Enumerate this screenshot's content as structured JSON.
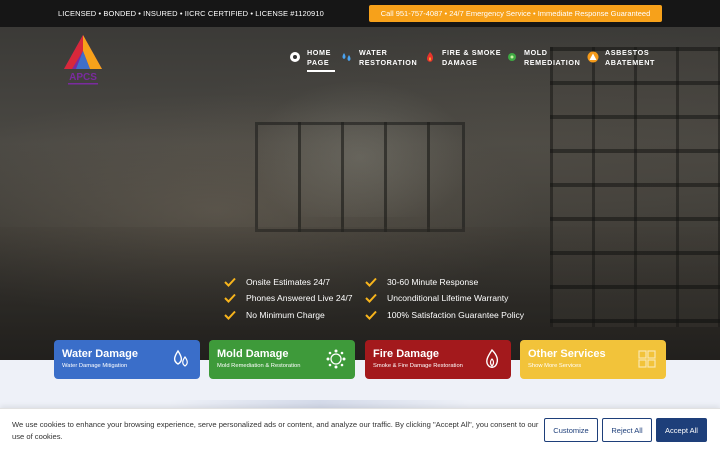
{
  "topbar": {
    "license_text": "LICENSED • BONDED • INSURED • IICRC CERTIFIED • LICENSE #1120910",
    "call_text": "Call 951-757-4087 • 24/7 Emergency Service • Immediate Response Guaranteed"
  },
  "logo": {
    "text": "APCS"
  },
  "nav": [
    {
      "line1": "HOME",
      "line2": "PAGE",
      "icon": "gear-house-icon"
    },
    {
      "line1": "WATER",
      "line2": "RESTORATION",
      "icon": "water-drops-icon"
    },
    {
      "line1": "FIRE & SMOKE",
      "line2": "DAMAGE",
      "icon": "fire-icon"
    },
    {
      "line1": "MOLD",
      "line2": "REMEDIATION",
      "icon": "mold-icon"
    },
    {
      "line1": "ASBESTOS",
      "line2": "ABATEMENT",
      "icon": "warning-icon"
    }
  ],
  "features_left": [
    "Onsite Estimates 24/7",
    "Phones Answered Live 24/7",
    "No Minimum Charge"
  ],
  "features_right": [
    "30-60 Minute Response",
    "Unconditional Lifetime Warranty",
    "100% Satisfaction Guarantee Policy"
  ],
  "services": [
    {
      "title": "Water Damage",
      "subtitle": "Water Damage Mitigation",
      "color": "#3a6ec9",
      "icon": "water-drop-icon"
    },
    {
      "title": "Mold Damage",
      "subtitle": "Mold Remediation & Restoration",
      "color": "#3e9a3a",
      "icon": "mold-spore-icon"
    },
    {
      "title": "Fire Damage",
      "subtitle": "Smoke & Fire Damage Restoration",
      "color": "#a3191c",
      "icon": "flame-icon"
    },
    {
      "title": "Other Services",
      "subtitle": "Show More Services",
      "color": "#f2c33a",
      "icon": "grid-icon"
    }
  ],
  "cookie": {
    "text": "We use cookies to enhance your browsing experience, serve personalized ads or content, and analyze our traffic. By clicking \"Accept All\", you consent to our use of cookies.",
    "customize": "Customize",
    "reject": "Reject All",
    "accept": "Accept All"
  },
  "colors": {
    "accent": "#f7a11a",
    "brand_blue": "#1e3f7a",
    "check": "#f7b41c"
  }
}
